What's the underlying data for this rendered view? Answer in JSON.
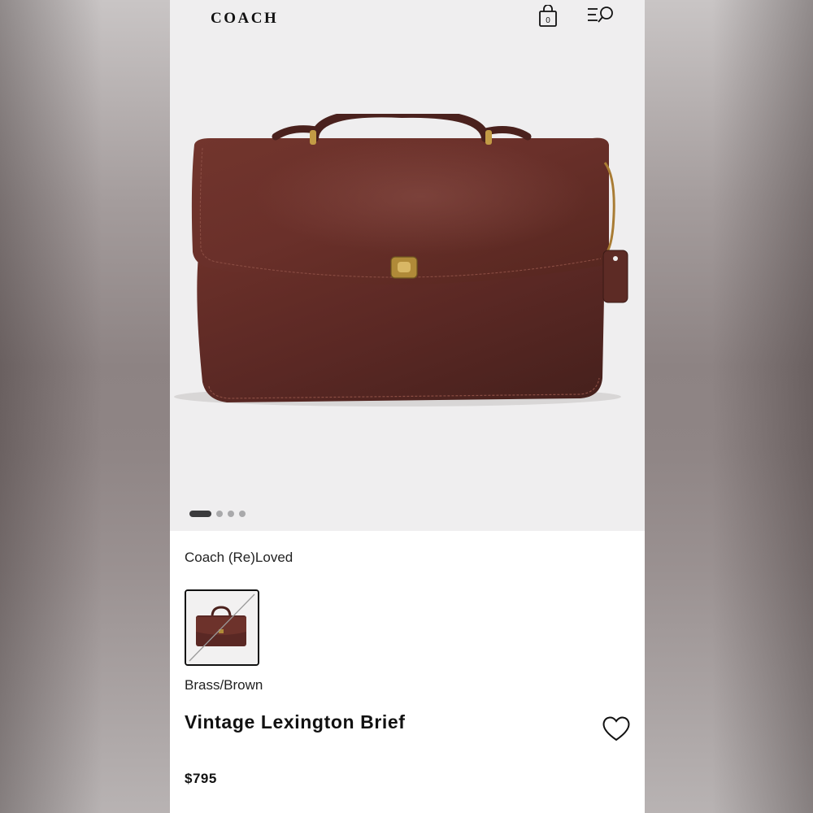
{
  "header": {
    "logo_text": "COACH",
    "bag_count": "0",
    "bag_icon": "shopping-bag-icon",
    "menu_icon": "menu-search-icon"
  },
  "gallery": {
    "image_count": 4,
    "active_index": 0
  },
  "product": {
    "collection": "Coach (Re)Loved",
    "color_name": "Brass/Brown",
    "title": "Vintage Lexington Brief",
    "price": "$795",
    "wishlist_icon": "heart-icon"
  },
  "colors": {
    "leather": "#5a2a24",
    "hardware": "#b8923a",
    "background": "#efeeef"
  }
}
